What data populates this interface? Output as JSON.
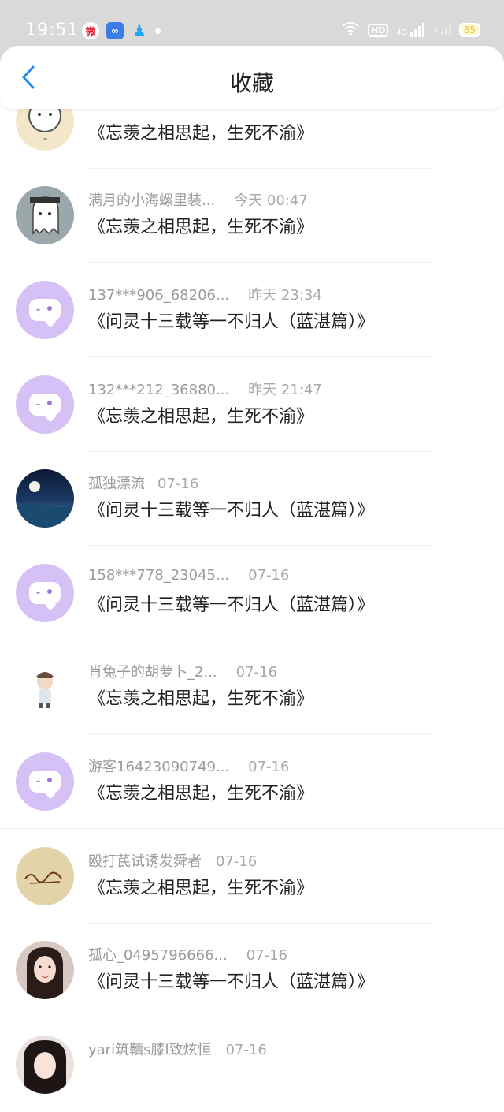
{
  "status_bar": {
    "time": "19:51",
    "battery": "85",
    "hd_label": "HD",
    "network": "4G"
  },
  "nav": {
    "title": "收藏"
  },
  "items": [
    {
      "name": "",
      "time": "",
      "title": "《忘羡之相思起，生死不渝》"
    },
    {
      "name": "满月的小海螺里装...",
      "time": "今天 00:47",
      "title": "《忘羡之相思起，生死不渝》"
    },
    {
      "name": "137***906_68206...",
      "time": "昨天 23:34",
      "title": "《问灵十三载等一不归人（蓝湛篇）》"
    },
    {
      "name": "132***212_36880...",
      "time": "昨天 21:47",
      "title": "《忘羡之相思起，生死不渝》"
    },
    {
      "name": "孤独漂流",
      "time": "07-16",
      "title": "《问灵十三载等一不归人（蓝湛篇）》"
    },
    {
      "name": "158***778_23045...",
      "time": "07-16",
      "title": "《问灵十三载等一不归人（蓝湛篇）》"
    },
    {
      "name": "肖兔子的胡萝卜_2...",
      "time": "07-16",
      "title": "《忘羡之相思起，生死不渝》"
    },
    {
      "name": "游客16423090749...",
      "time": "07-16",
      "title": "《忘羡之相思起，生死不渝》"
    },
    {
      "name": "殴打芪试诱发舜者",
      "time": "07-16",
      "title": "《忘羡之相思起，生死不渝》"
    },
    {
      "name": "孤心_0495796666...",
      "time": "07-16",
      "title": "《问灵十三载等一不归人（蓝湛篇）》"
    },
    {
      "name": "yari筑韇s膝l致炫恒",
      "time": "07-16",
      "title": ""
    }
  ]
}
